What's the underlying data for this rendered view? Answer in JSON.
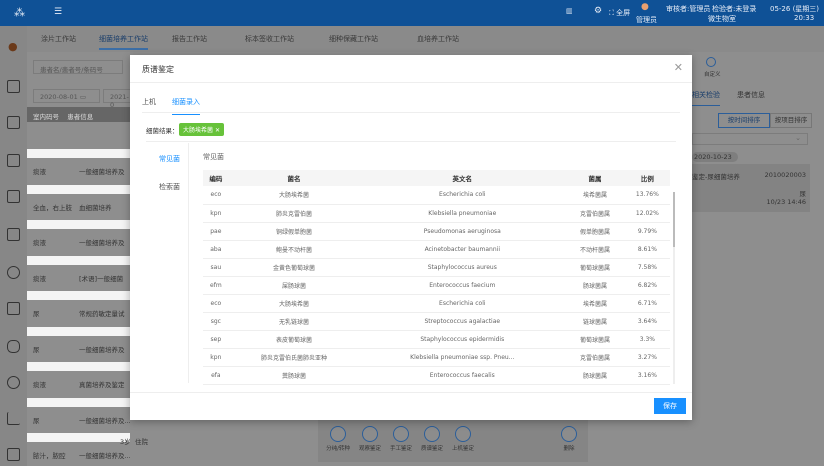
{
  "header": {
    "fullscreen": "全屏",
    "user": "管理员",
    "reviewer": "审核者:管理员",
    "tester": "检验者:未登录",
    "date": "05-26 (星期三)",
    "dept": "微生物室",
    "time": "20:33"
  },
  "tabs": [
    "涂片工作站",
    "细菌培养工作站",
    "报告工作站",
    "标本签收工作站",
    "细种保藏工作站",
    "血培养工作站"
  ],
  "active_tab": 1,
  "background": {
    "search_placeholder": "患者名/患者号/条码号",
    "date_from": "2020-08-01",
    "date_to": "2021-0",
    "patient_type": "患者类型",
    "sample_type": "标本类",
    "list_headers": [
      "室内码号",
      "患者信息"
    ],
    "rows": [
      [
        "痰液",
        "一般细菌培养及"
      ],
      [
        "全血，右上肢",
        "血细菌培养"
      ],
      [
        "痰液",
        "一般细菌培养及"
      ],
      [
        "痰液",
        "[术语]一般细菌"
      ],
      [
        "尿",
        "常规药敏定量试"
      ],
      [
        "尿",
        "一般细菌培养及"
      ],
      [
        "痰液",
        "真菌培养及鉴定"
      ],
      [
        "尿",
        "一般细菌培养及..."
      ],
      [
        "脓汁，脓腔",
        "一般细菌培养及..."
      ]
    ],
    "age_text": "3岁",
    "inpatient": "住院",
    "right": {
      "custom": "自定义",
      "tab_related": "相关检验",
      "tab_patient": "患者信息",
      "sort_time": "按时间排序",
      "sort_item": "按项目排序",
      "date_chip": "2020-10-23",
      "item": "鉴定-尿细菌培养",
      "code": "2010020003",
      "sample": "尿",
      "time": "10/23 14:46"
    },
    "toolbar": [
      "分纯/转种",
      "观察鉴定",
      "手工鉴定",
      "质谱鉴定",
      "上机鉴定",
      "删除"
    ]
  },
  "modal": {
    "title": "质谱鉴定",
    "tabs": [
      "上机",
      "细菌录入"
    ],
    "active_tab": 1,
    "result_label": "细菌结果：",
    "result_tag": "大肠埃希菌",
    "nav": [
      "常见菌",
      "检索菌"
    ],
    "section_title": "常见菌",
    "columns": [
      "编码",
      "菌名",
      "英文名",
      "菌属",
      "比例"
    ],
    "rows": [
      [
        "eco",
        "大肠埃希菌",
        "Escherichia coli",
        "埃希菌属",
        "13.76%"
      ],
      [
        "kpn",
        "肺炎克雷伯菌",
        "Klebsiella pneumoniae",
        "克雷伯菌属",
        "12.02%"
      ],
      [
        "pae",
        "铜绿假单胞菌",
        "Pseudomonas aeruginosa",
        "假单胞菌属",
        "9.79%"
      ],
      [
        "aba",
        "鲍曼不动杆菌",
        "Acinetobacter baumannii",
        "不动杆菌属",
        "8.61%"
      ],
      [
        "sau",
        "金黄色葡萄球菌",
        "Staphylococcus aureus",
        "葡萄球菌属",
        "7.58%"
      ],
      [
        "efm",
        "屎肠球菌",
        "Enterococcus faecium",
        "肠球菌属",
        "6.82%"
      ],
      [
        "eco",
        "大肠埃希菌",
        "Escherichia coli",
        "埃希菌属",
        "6.71%"
      ],
      [
        "sgc",
        "无乳链球菌",
        "Streptococcus agalactiae",
        "链球菌属",
        "3.64%"
      ],
      [
        "sep",
        "表皮葡萄球菌",
        "Staphylococcus epidermidis",
        "葡萄球菌属",
        "3.3%"
      ],
      [
        "kpn",
        "肺炎克雷伯氏菌肺炎亚种",
        "Klebsiella pneumoniae ssp. Pneu...",
        "克雷伯菌属",
        "3.27%"
      ],
      [
        "efa",
        "粪肠球菌",
        "Enterococcus faecalis",
        "肠球菌属",
        "3.16%"
      ]
    ],
    "save": "保存"
  }
}
